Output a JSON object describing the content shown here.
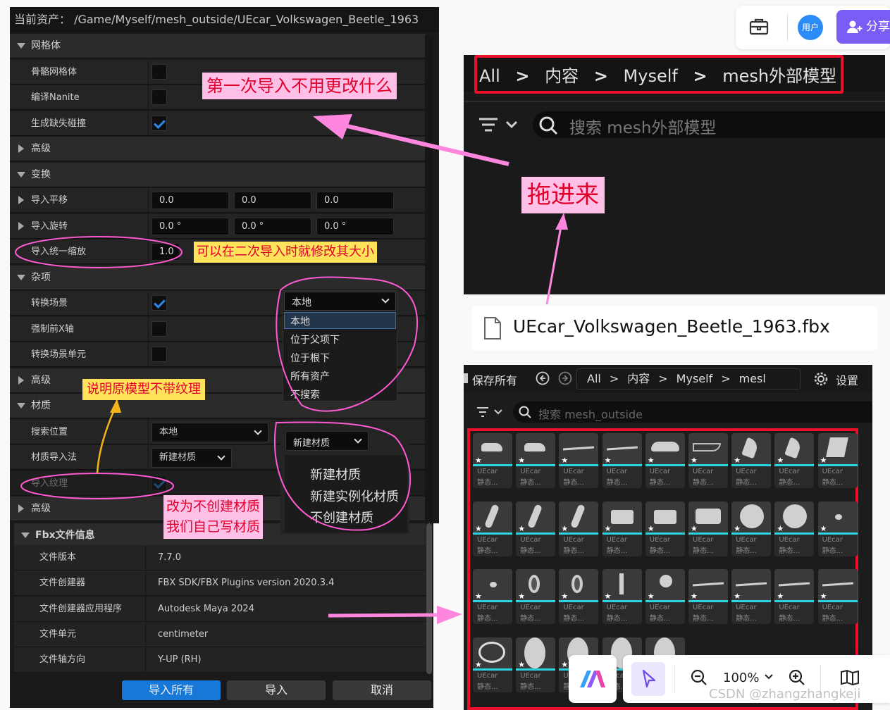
{
  "dialog": {
    "title": "当前资产：  /Game/Myself/mesh_outside/UEcar_Volkswagen_Beetle_1963",
    "sections": {
      "mesh": "网格体",
      "transform": "变换",
      "misc": "杂项",
      "material": "材质",
      "fbx": "Fbx文件信息"
    },
    "props": {
      "skeletal": "骨骼网格体",
      "nanite": "编译Nanite",
      "collision": "生成缺失碰撞",
      "advanced": "高级",
      "translation": "导入平移",
      "rotation": "导入旋转",
      "scale": "导入统一缩放",
      "convert_scene": "转换场景",
      "force_x": "强制前X轴",
      "convert_units": "转换场景单元",
      "search_location": "搜索位置",
      "material_method": "材质导入法",
      "import_textures": "导入纹理"
    },
    "values": {
      "translation": [
        "0.0",
        "0.0",
        "0.0"
      ],
      "rotation": [
        "0.0 °",
        "0.0 °",
        "0.0 °"
      ],
      "scale": "1.0",
      "search_location": "本地",
      "material_method": "新建材质"
    },
    "fbx_info": [
      {
        "label": "文件版本",
        "value": "7.7.0"
      },
      {
        "label": "文件创建器",
        "value": "FBX SDK/FBX Plugins version 2020.3.4"
      },
      {
        "label": "文件创建器应用程序",
        "value": "Autodesk Maya 2024"
      },
      {
        "label": "文件单元",
        "value": "centimeter"
      },
      {
        "label": "文件轴方向",
        "value": "Y-UP (RH)"
      }
    ],
    "buttons": {
      "import_all": "导入所有",
      "import": "导入",
      "cancel": "取消"
    },
    "search_dropdown": {
      "selected": "本地",
      "options": [
        "本地",
        "位于父项下",
        "位于根下",
        "所有资产",
        "不搜索"
      ]
    },
    "material_dropdown": {
      "selected": "新建材质",
      "options": [
        "新建材质",
        "新建实例化材质",
        "不创建材质"
      ]
    }
  },
  "annotations": {
    "first_import": "第一次导入不用更改什么",
    "scale_note": "可以在二次导入时就修改其大小",
    "no_texture": "说明原模型不带纹理",
    "change_material_1": "改为不创建材质",
    "change_material_2": "我们自己写材质",
    "drag_in": "拖进来"
  },
  "content_browser_top": {
    "breadcrumb": [
      "All",
      "内容",
      "Myself",
      "mesh外部模型"
    ],
    "search_placeholder": "搜索 mesh外部模型"
  },
  "file_name": "UEcar_Volkswagen_Beetle_1963.fbx",
  "content_browser_bottom": {
    "save_all": "保存所有",
    "breadcrumb": [
      "All",
      "内容",
      "Myself",
      "mesl"
    ],
    "settings": "设置",
    "search_placeholder": "搜索 mesh_outside",
    "tile_title": "UEcar",
    "tile_type": "静态..."
  },
  "toolbar": {
    "share": "分享",
    "user": "用户",
    "zoom": "100%"
  },
  "watermark": "CSDN @zhangzhangkeji"
}
